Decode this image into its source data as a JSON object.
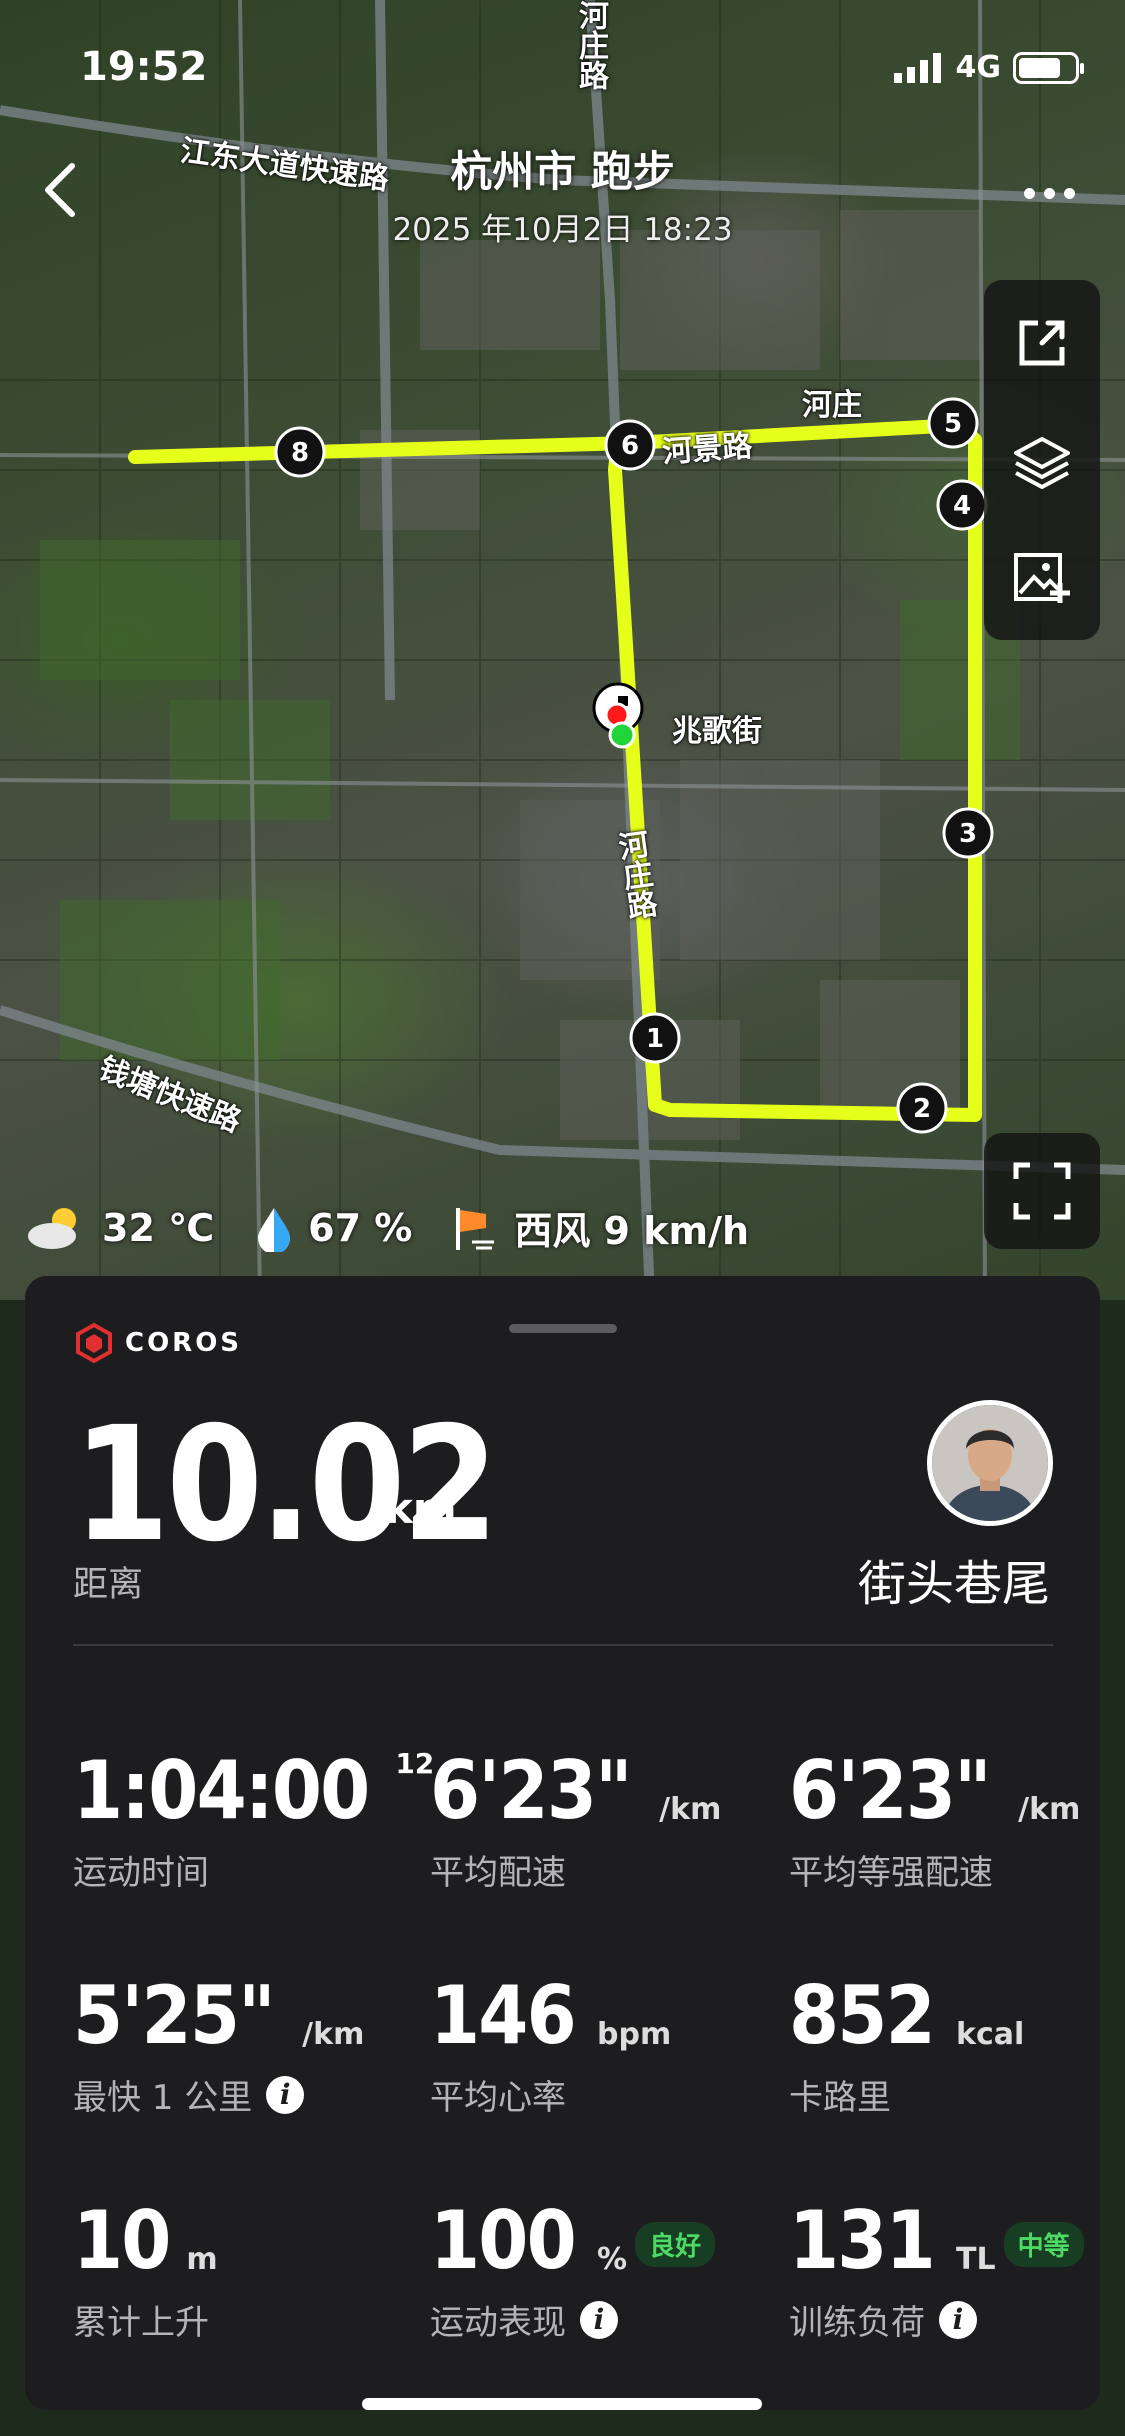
{
  "status_bar": {
    "time": "19:52",
    "network": "4G",
    "battery_level": 0.75
  },
  "header": {
    "title": "杭州市 跑步",
    "subtitle": "2025 年10月2日 18:23",
    "back_icon": "chevron-left-icon",
    "more_icon": "more-dots-icon"
  },
  "map": {
    "labels": [
      "江东大道快速路",
      "河庄路",
      "河庄",
      "河景路",
      "兆歌街",
      "河庄路",
      "钱塘快速路"
    ],
    "route_color": "#e6ff1a",
    "km_markers": [
      "1",
      "2",
      "3",
      "4",
      "5",
      "6",
      "8"
    ],
    "tools": [
      "share-icon",
      "layers-icon",
      "add-photo-icon",
      "fullscreen-icon"
    ]
  },
  "weather": {
    "temperature": "32 ℃",
    "humidity": "67 %",
    "wind": "西风 9 km/h"
  },
  "summary": {
    "brand": "COROS",
    "distance_value": "10.02",
    "distance_unit": "km",
    "distance_label": "距离",
    "username": "街头巷尾"
  },
  "stats": [
    {
      "value": "1:04:00",
      "sup": "12",
      "unit": "",
      "label": "运动时间"
    },
    {
      "value": "6'23\"",
      "unit": "/km",
      "label": "平均配速"
    },
    {
      "value": "6'23\"",
      "unit": "/km",
      "label": "平均等强配速"
    },
    {
      "value": "5'25\"",
      "unit": "/km",
      "label": "最快 1 公里",
      "info": true
    },
    {
      "value": "146",
      "unit": "bpm",
      "label": "平均心率"
    },
    {
      "value": "852",
      "unit": "kcal",
      "label": "卡路里"
    },
    {
      "value": "10",
      "unit": "m",
      "label": "累计上升"
    },
    {
      "value": "100",
      "unit": "%",
      "badge": "良好",
      "label": "运动表现",
      "info": true
    },
    {
      "value": "131",
      "unit": "TL",
      "badge": "中等",
      "label": "训练负荷",
      "info": true
    }
  ],
  "colors": {
    "accent_green": "#4cd964",
    "brand_red": "#e0302f",
    "card_bg": "#1d1d1f"
  }
}
